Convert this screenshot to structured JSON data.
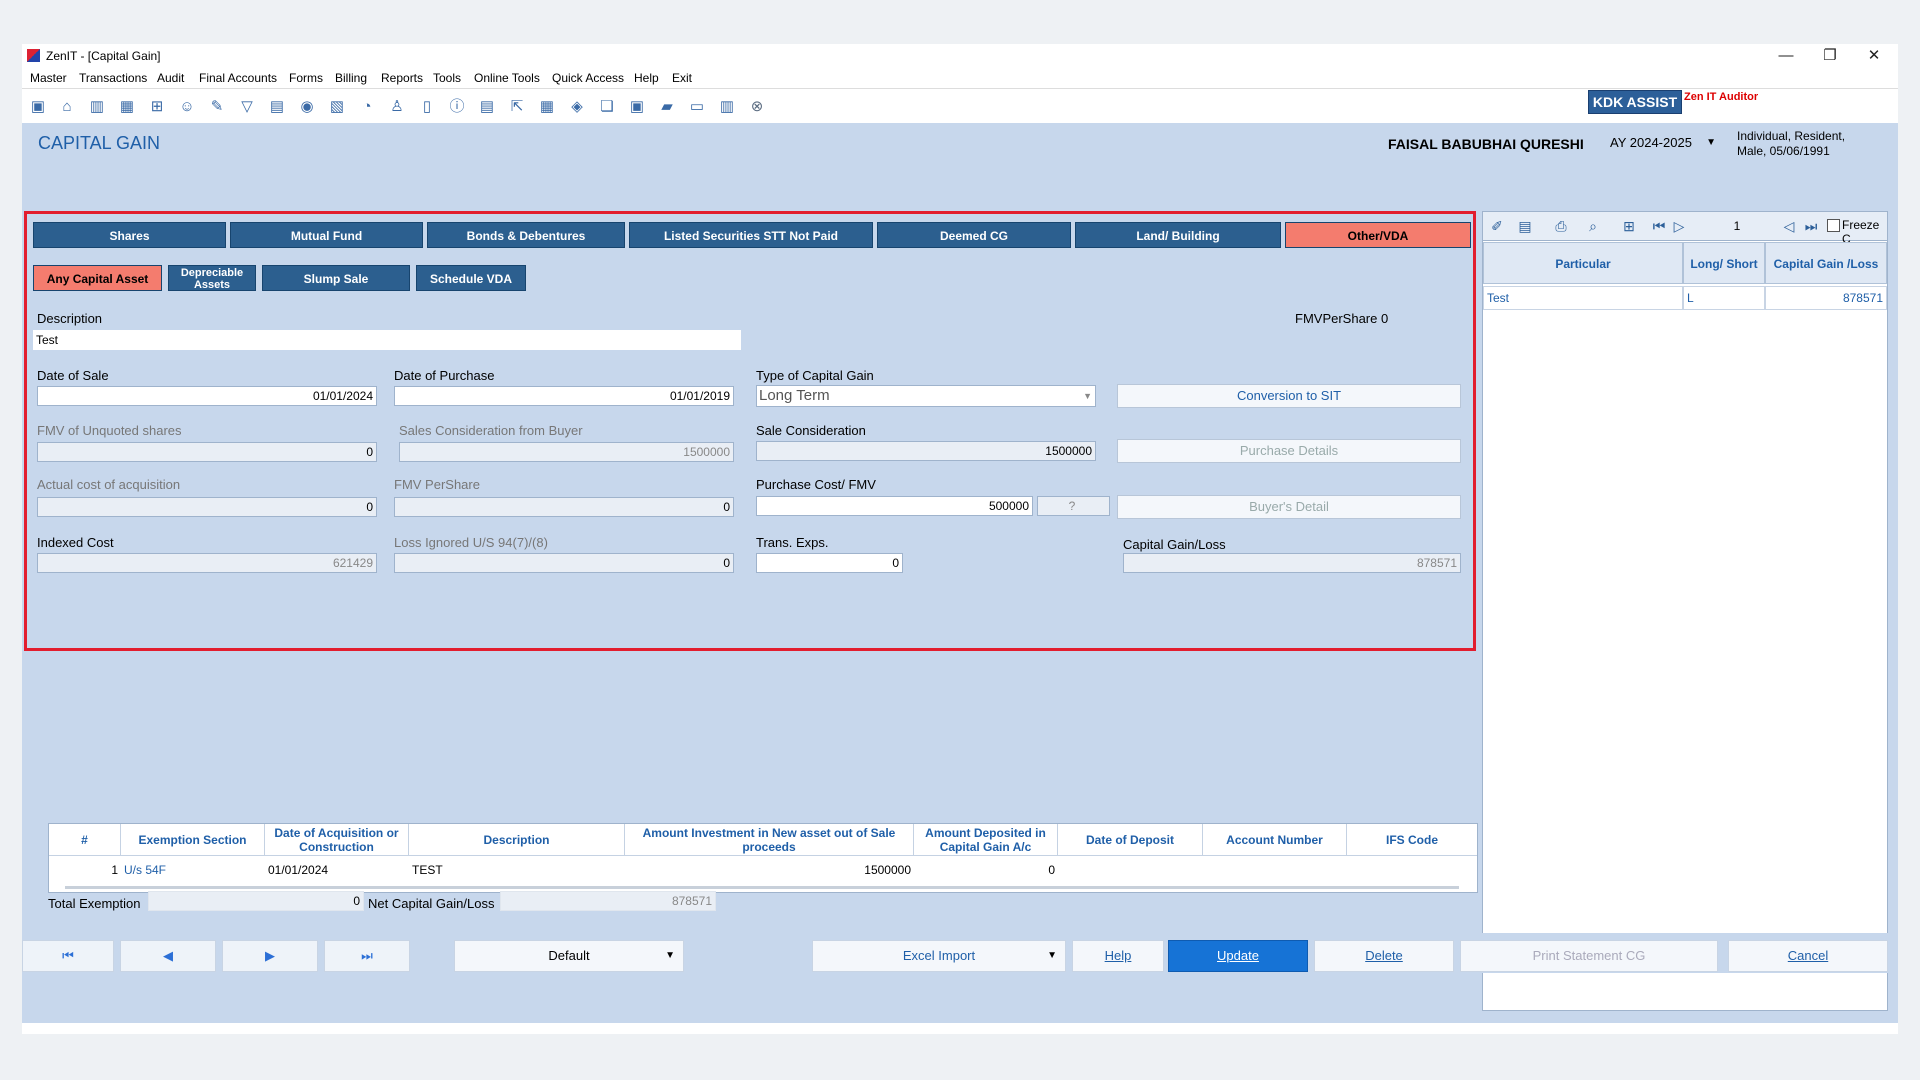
{
  "window": {
    "title": "ZenIT - [Capital Gain]",
    "controls": [
      "—",
      "❐",
      "✕"
    ]
  },
  "menu": [
    "Master",
    "Transactions",
    "Audit",
    "Final Accounts",
    "Forms",
    "Billing",
    "Reports",
    "Tools",
    "Online Tools",
    "Quick Access",
    "Help",
    "Exit"
  ],
  "branding": {
    "kdk_assist": "KDK ASSIST",
    "zen_auditor": "Zen IT Auditor"
  },
  "header": {
    "page_title": "CAPITAL GAIN",
    "person_name": "FAISAL BABUBHAI QURESHI",
    "assessment_year": "AY 2024-2025",
    "person_info_line1": "Individual, Resident,",
    "person_info_line2": "Male, 05/06/1991"
  },
  "tabs": [
    "Shares",
    "Mutual Fund",
    "Bonds & Debentures",
    "Listed Securities STT Not Paid",
    "Deemed CG",
    "Land/ Building",
    "Other/VDA"
  ],
  "active_tab": "Other/VDA",
  "subtabs": [
    "Any Capital Asset",
    "Depreciable Assets",
    "Slump Sale",
    "Schedule VDA"
  ],
  "active_subtab": "Any Capital Asset",
  "form": {
    "description_label": "Description",
    "description_value": "Test",
    "fmv_per_share_note": "FMVPerShare 0",
    "date_of_sale_label": "Date of Sale",
    "date_of_sale_value": "01/01/2024",
    "date_of_purchase_label": "Date of Purchase",
    "date_of_purchase_value": "01/01/2019",
    "type_of_cg_label": "Type of Capital Gain",
    "type_of_cg_value": "Long Term",
    "conversion_button": "Conversion to SIT",
    "fmv_unquoted_label": "FMV of Unquoted shares",
    "fmv_unquoted_value": "0",
    "sales_consideration_buyer_label": "Sales Consideration from Buyer",
    "sales_consideration_buyer_value": "1500000",
    "sale_consideration_label": "Sale Consideration",
    "sale_consideration_value": "1500000",
    "purchase_details_button": "Purchase Details",
    "actual_cost_label": "Actual cost of acquisition",
    "actual_cost_value": "0",
    "fmv_pershare_label": "FMV PerShare",
    "fmv_pershare_value": "0",
    "purchase_cost_label": "Purchase Cost/ FMV",
    "purchase_cost_value": "500000",
    "purchase_cost_aux": "?",
    "buyers_detail_button": "Buyer's Detail",
    "indexed_cost_label": "Indexed Cost",
    "indexed_cost_value": "621429",
    "loss_ignored_label": "Loss Ignored U/S 94(7)/(8)",
    "loss_ignored_value": "0",
    "trans_exps_label": "Trans. Exps.",
    "trans_exps_value": "0",
    "capital_gain_loss_label": "Capital Gain/Loss",
    "capital_gain_loss_value": "878571"
  },
  "side_panel": {
    "page_number": "1",
    "freeze_label": "Freeze C",
    "headers": [
      "Particular",
      "Long/ Short",
      "Capital Gain /Loss"
    ],
    "rows": [
      {
        "particular": "Test",
        "long_short": "L",
        "capital_gain": "878571"
      }
    ]
  },
  "exemption_grid": {
    "headers": [
      "#",
      "Exemption Section",
      "Date of Acquisition or Construction",
      "Description",
      "Amount Investment in New asset out of Sale proceeds",
      "Amount Deposited in Capital Gain A/c",
      "Date of Deposit",
      "Account Number",
      "IFS Code"
    ],
    "rows": [
      {
        "num": "1",
        "section": "U/s 54F",
        "date": "01/01/2024",
        "description": "TEST",
        "amount_invested": "1500000",
        "amount_deposited": "0",
        "date_of_deposit": "",
        "account_number": "",
        "ifs_code": ""
      }
    ]
  },
  "totals": {
    "total_exemption_label": "Total Exemption",
    "total_exemption_value": "0",
    "net_cg_label": "Net Capital Gain/Loss",
    "net_cg_value": "878571"
  },
  "bottom_bar": {
    "nav_first": "⏮",
    "nav_prev": "◀",
    "nav_next": "▶",
    "nav_last": "⏭",
    "default_select": "Default",
    "excel_import": "Excel Import",
    "help": "Help",
    "update": "Update",
    "delete": "Delete",
    "print_statement": "Print Statement CG",
    "cancel": "Cancel"
  }
}
